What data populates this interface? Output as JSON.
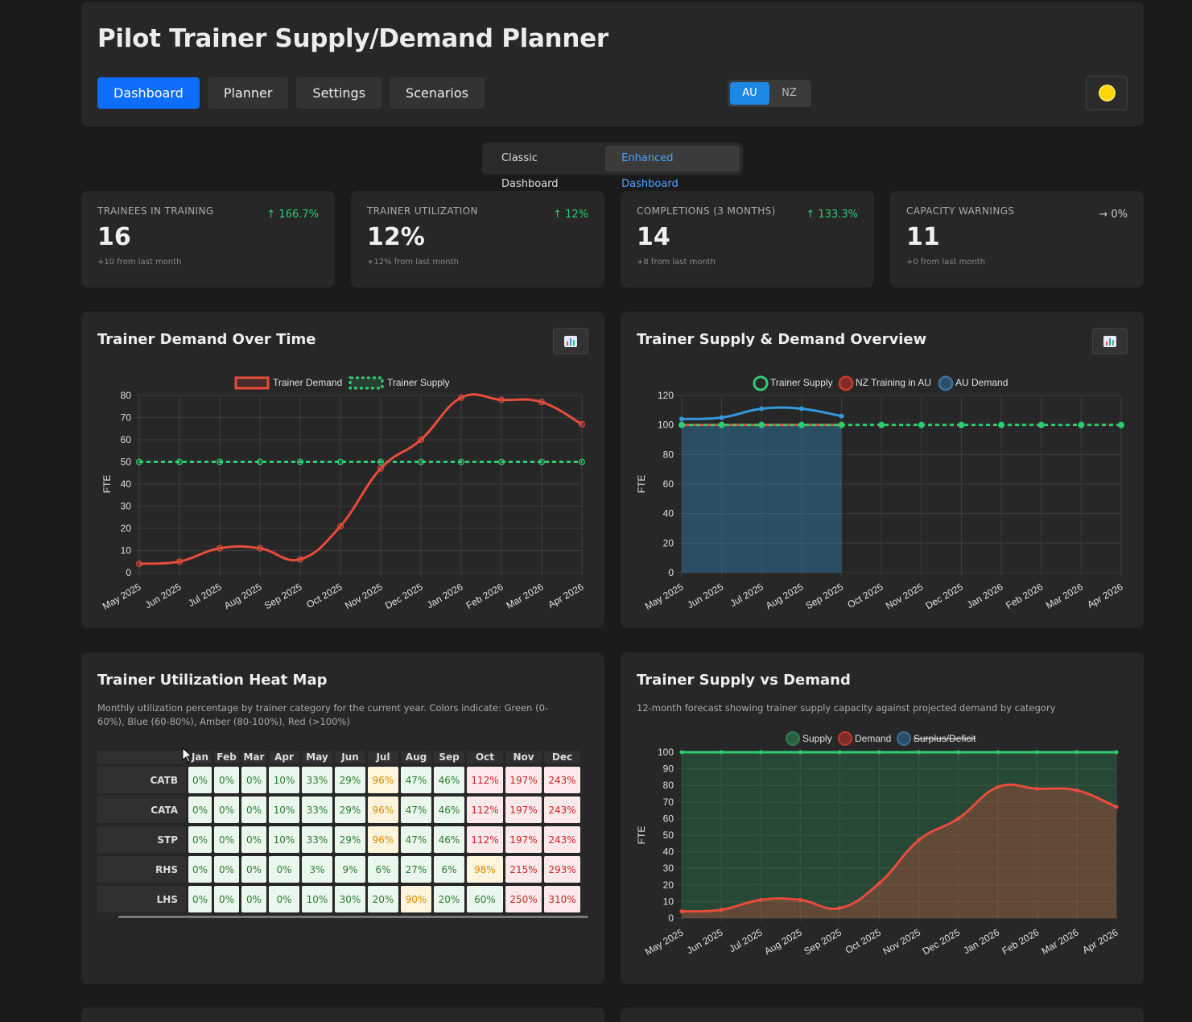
{
  "app": {
    "title": "Pilot Trainer Supply/Demand Planner",
    "nav": [
      "Dashboard",
      "Planner",
      "Settings",
      "Scenarios"
    ],
    "active_nav": "Dashboard",
    "regions": [
      "AU",
      "NZ"
    ],
    "active_region": "AU",
    "theme_icon": "sun-icon"
  },
  "dashboard_toggle": {
    "tabs": [
      "Classic Dashboard",
      "Enhanced Dashboard"
    ],
    "active": "Enhanced Dashboard"
  },
  "kpis": [
    {
      "label": "TRAINEES IN TRAINING",
      "value": "16",
      "change": "↑ 166.7%",
      "sub": "+10 from last month"
    },
    {
      "label": "TRAINER UTILIZATION",
      "value": "12%",
      "change": "↑ 12%",
      "sub": "+12% from last month"
    },
    {
      "label": "COMPLETIONS (3 MONTHS)",
      "value": "14",
      "change": "↑ 133.3%",
      "sub": "+8 from last month"
    },
    {
      "label": "CAPACITY WARNINGS",
      "value": "11",
      "change": "→ 0%",
      "sub": "+0 from last month"
    }
  ],
  "colors": {
    "demand": "#e74c3c",
    "supply": "#2ecc71",
    "au_demand": "#3498db",
    "accent": "#0d6efd"
  },
  "chart_data": [
    {
      "type": "line",
      "title": "Trainer Demand Over Time",
      "ylabel": "FTE",
      "ylim": [
        0,
        80
      ],
      "yticks": [
        0,
        10,
        20,
        30,
        40,
        50,
        60,
        70,
        80
      ],
      "categories": [
        "May 2025",
        "Jun 2025",
        "Jul 2025",
        "Aug 2025",
        "Sep 2025",
        "Oct 2025",
        "Nov 2025",
        "Dec 2025",
        "Jan 2026",
        "Feb 2026",
        "Mar 2026",
        "Apr 2026"
      ],
      "series": [
        {
          "name": "Trainer Demand",
          "values": [
            4,
            5,
            11,
            11,
            6,
            21,
            47,
            60,
            79,
            78,
            77,
            67
          ]
        },
        {
          "name": "Trainer Supply",
          "values": [
            50,
            50,
            50,
            50,
            50,
            50,
            50,
            50,
            50,
            50,
            50,
            50
          ]
        }
      ],
      "legend": "top",
      "grid": true
    },
    {
      "type": "line",
      "title": "Trainer Supply & Demand Overview",
      "ylabel": "FTE",
      "ylim": [
        0,
        120
      ],
      "yticks": [
        0,
        20,
        40,
        60,
        80,
        100,
        120
      ],
      "categories": [
        "May 2025",
        "Jun 2025",
        "Jul 2025",
        "Aug 2025",
        "Sep 2025",
        "Oct 2025",
        "Nov 2025",
        "Dec 2025",
        "Jan 2026",
        "Feb 2026",
        "Mar 2026",
        "Apr 2026"
      ],
      "series": [
        {
          "name": "Trainer Supply",
          "values": [
            100,
            100,
            100,
            100,
            100,
            100,
            100,
            100,
            100,
            100,
            100,
            100
          ]
        },
        {
          "name": "NZ Training in AU",
          "values": [
            100,
            100,
            100,
            100,
            100,
            null,
            null,
            null,
            null,
            null,
            null,
            null
          ]
        },
        {
          "name": "AU Demand",
          "values": [
            104,
            105,
            111,
            111,
            106,
            null,
            null,
            null,
            null,
            null,
            null,
            null
          ]
        }
      ],
      "legend": "top",
      "grid": true
    },
    {
      "type": "area",
      "title": "Trainer Supply vs Demand",
      "subtitle": "12-month forecast showing trainer supply capacity against projected demand by category",
      "ylabel": "FTE",
      "ylim": [
        0,
        100
      ],
      "yticks": [
        0,
        10,
        20,
        30,
        40,
        50,
        60,
        70,
        80,
        90,
        100
      ],
      "categories": [
        "May 2025",
        "Jun 2025",
        "Jul 2025",
        "Aug 2025",
        "Sep 2025",
        "Oct 2025",
        "Nov 2025",
        "Dec 2025",
        "Jan 2026",
        "Feb 2026",
        "Mar 2026",
        "Apr 2026"
      ],
      "series": [
        {
          "name": "Supply",
          "values": [
            100,
            100,
            100,
            100,
            100,
            100,
            100,
            100,
            100,
            100,
            100,
            100
          ]
        },
        {
          "name": "Demand",
          "values": [
            4,
            5,
            11,
            11,
            6,
            21,
            47,
            60,
            79,
            78,
            77,
            67
          ]
        },
        {
          "name": "Surplus/Deficit",
          "hidden": true
        }
      ],
      "legend": "top",
      "grid": true
    }
  ],
  "heatmap": {
    "title": "Trainer Utilization Heat Map",
    "description": "Monthly utilization percentage by trainer category for the current year. Colors indicate: Green (0-60%), Blue (60-80%), Amber (80-100%), Red (>100%)",
    "months": [
      "Jan",
      "Feb",
      "Mar",
      "Apr",
      "May",
      "Jun",
      "Jul",
      "Aug",
      "Sep",
      "Oct",
      "Nov",
      "Dec"
    ],
    "rows": [
      {
        "label": "CATB",
        "values": [
          0,
          0,
          0,
          10,
          33,
          29,
          96,
          47,
          46,
          112,
          197,
          243
        ]
      },
      {
        "label": "CATA",
        "values": [
          0,
          0,
          0,
          10,
          33,
          29,
          96,
          47,
          46,
          112,
          197,
          243
        ]
      },
      {
        "label": "STP",
        "values": [
          0,
          0,
          0,
          10,
          33,
          29,
          96,
          47,
          46,
          112,
          197,
          243
        ]
      },
      {
        "label": "RHS",
        "values": [
          0,
          0,
          0,
          0,
          3,
          9,
          6,
          27,
          6,
          98,
          215,
          293
        ]
      },
      {
        "label": "LHS",
        "values": [
          0,
          0,
          0,
          0,
          10,
          30,
          20,
          90,
          20,
          60,
          250,
          310
        ]
      }
    ]
  }
}
